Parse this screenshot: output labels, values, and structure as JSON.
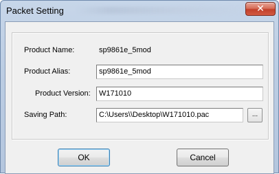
{
  "window": {
    "title": "Packet Setting",
    "close_glyph": "✕"
  },
  "form": {
    "product_name_label": "Product Name:",
    "product_name_value": "sp9861e_5mod",
    "product_alias_label": "Product Alias:",
    "product_alias_value": "sp9861e_5mod",
    "product_version_label": "Product Version:",
    "product_version_value": "W171010",
    "saving_path_label": "Saving Path:",
    "saving_path_value": "C:\\Users\\\\Desktop\\W171010.pac",
    "browse_label": "..."
  },
  "buttons": {
    "ok_label": "OK",
    "cancel_label": "Cancel"
  },
  "colors": {
    "title_bar": "#bccde3",
    "close_button": "#c2402a",
    "client_bg": "#f0f0f0",
    "default_button_border": "#3c7fb1"
  },
  "icons": {
    "close": "close-icon"
  }
}
